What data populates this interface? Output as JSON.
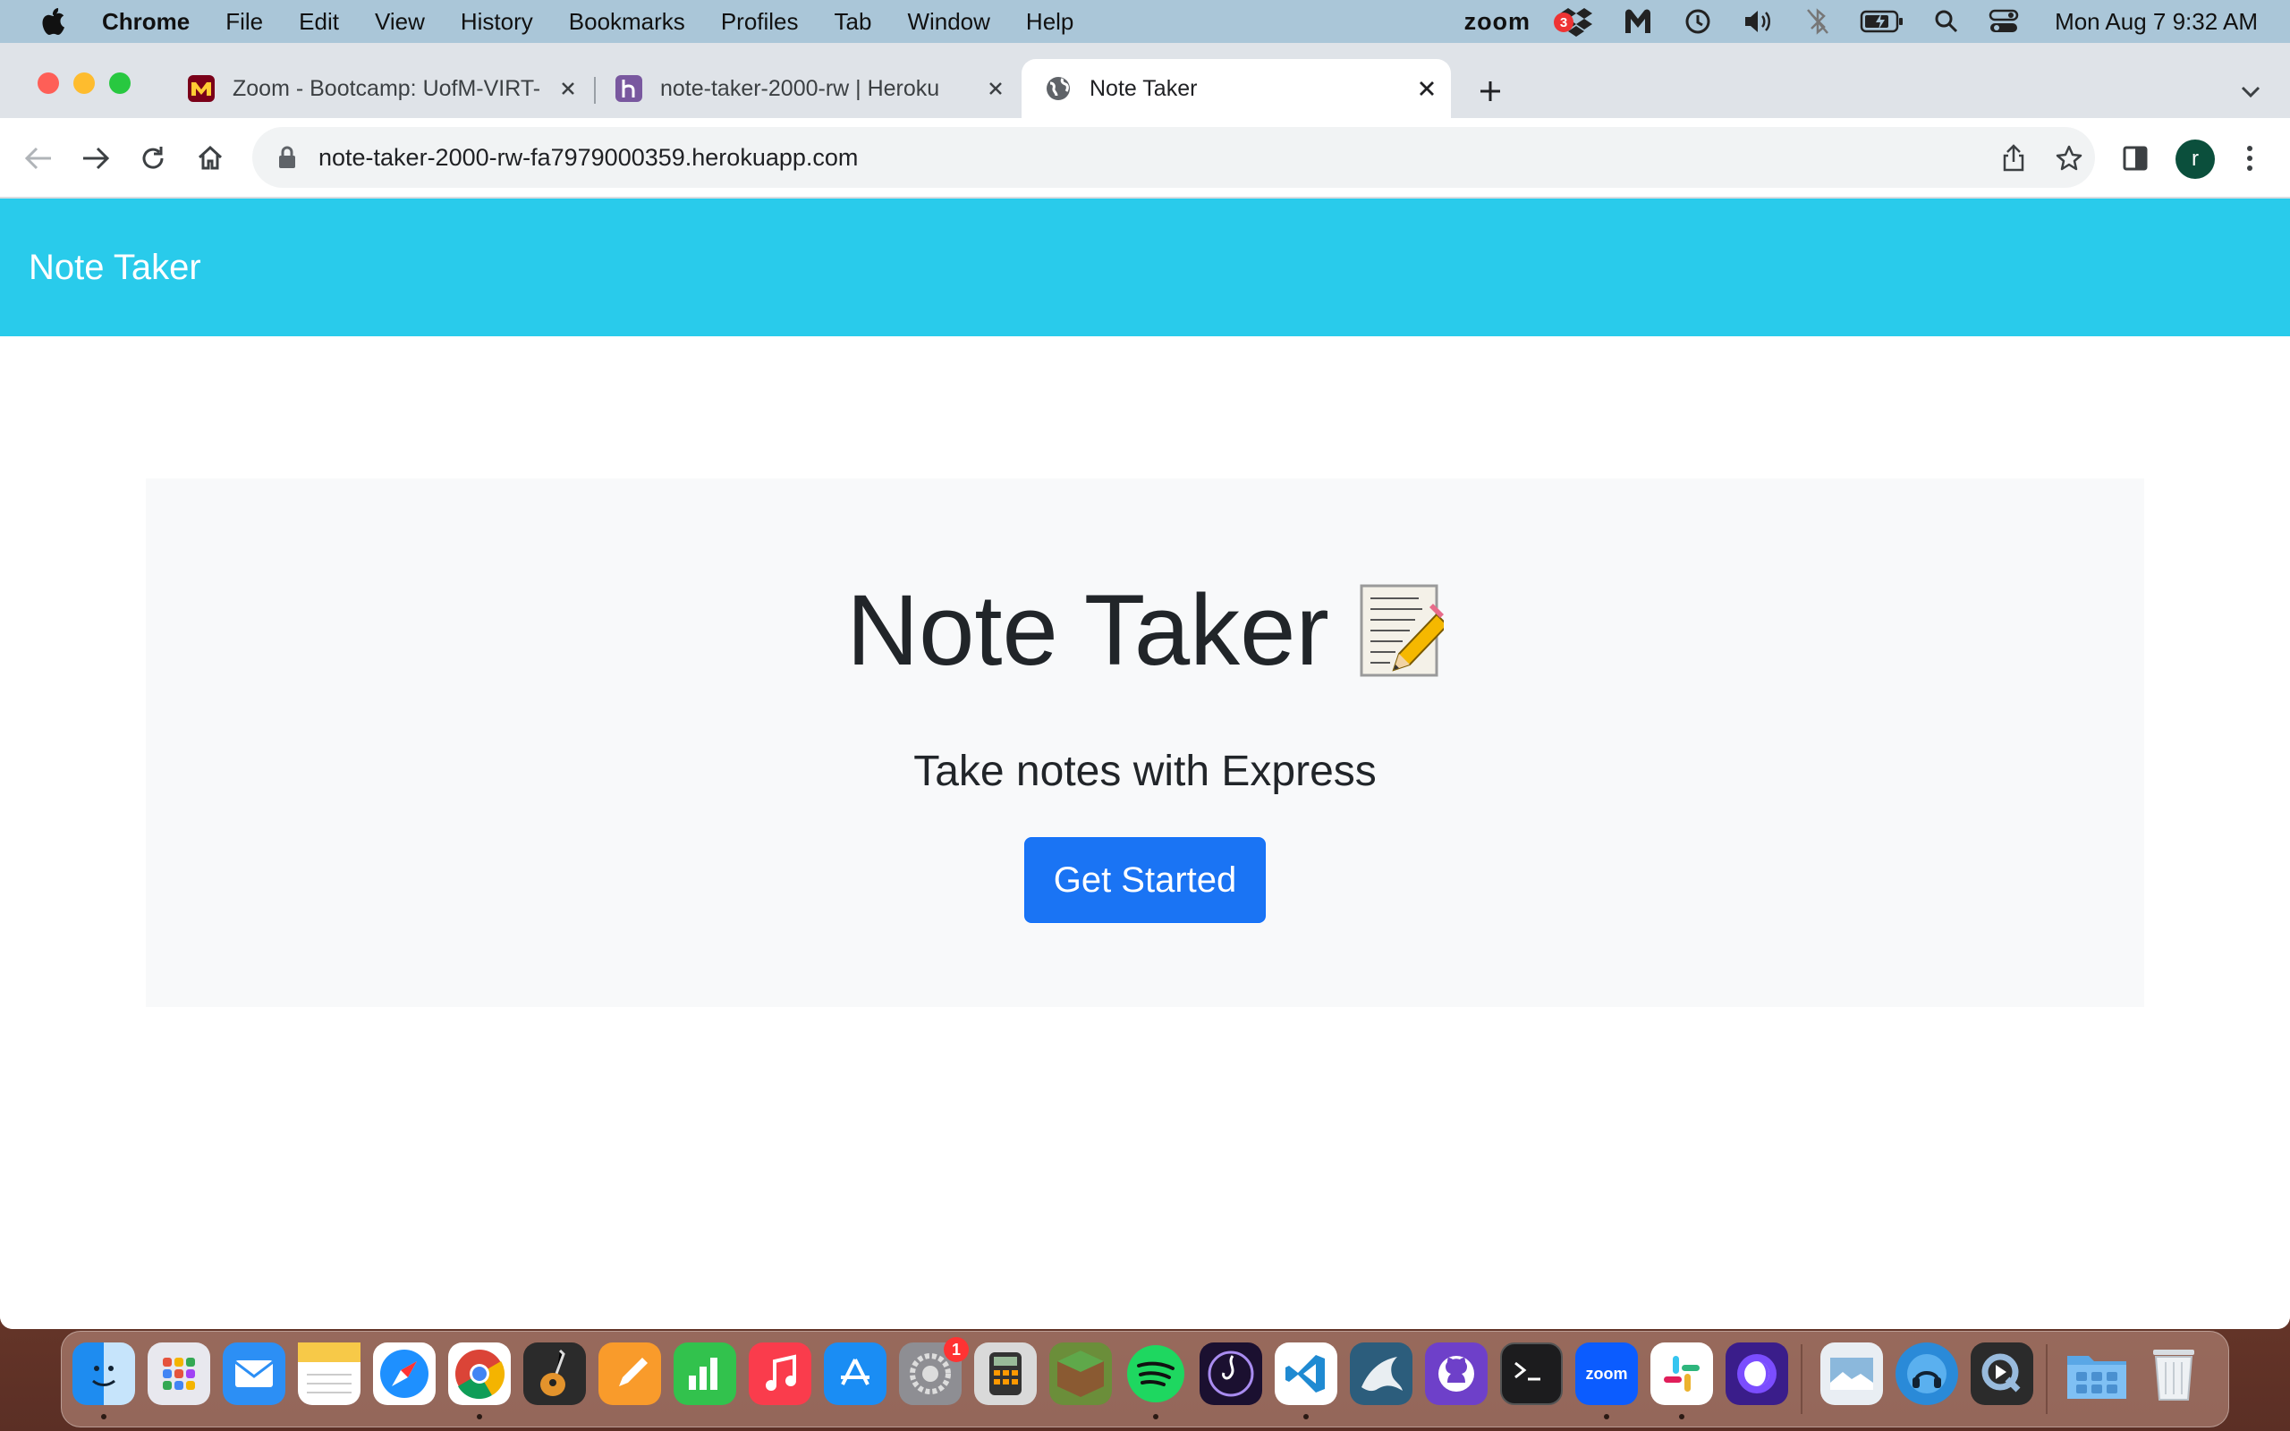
{
  "menubar": {
    "app": "Chrome",
    "items": [
      "File",
      "Edit",
      "View",
      "History",
      "Bookmarks",
      "Profiles",
      "Tab",
      "Window",
      "Help"
    ],
    "zoom_label": "zoom",
    "dropbox_badge": "3",
    "clock": "Mon Aug 7  9:32 AM"
  },
  "browser": {
    "tabs": [
      {
        "label": "Zoom - Bootcamp: UofM-VIRT-",
        "favicon": "umn-icon"
      },
      {
        "label": "note-taker-2000-rw | Heroku",
        "favicon": "heroku-icon"
      },
      {
        "label": "Note Taker",
        "favicon": "globe-icon",
        "active": true
      }
    ],
    "url": "note-taker-2000-rw-fa7979000359.herokuapp.com",
    "profile_initial": "r"
  },
  "page": {
    "navbar_brand": "Note Taker",
    "hero_title": "Note Taker",
    "hero_subtitle": "Take notes with Express",
    "cta_label": "Get Started"
  },
  "dock": {
    "zoom_label": "zoom",
    "settings_badge": "1",
    "apps": [
      "finder",
      "launchpad",
      "mail",
      "notes",
      "safari",
      "chrome",
      "garageband",
      "pages",
      "numbers",
      "music",
      "app-store",
      "system-settings",
      "calculator",
      "minecraft",
      "spotify",
      "audio-app",
      "vscode",
      "mysql-workbench",
      "github-desktop",
      "terminal",
      "zoom",
      "slack",
      "screen-recorder",
      "preview",
      "remote-desktop",
      "quicktime",
      "downloads",
      "trash"
    ]
  }
}
